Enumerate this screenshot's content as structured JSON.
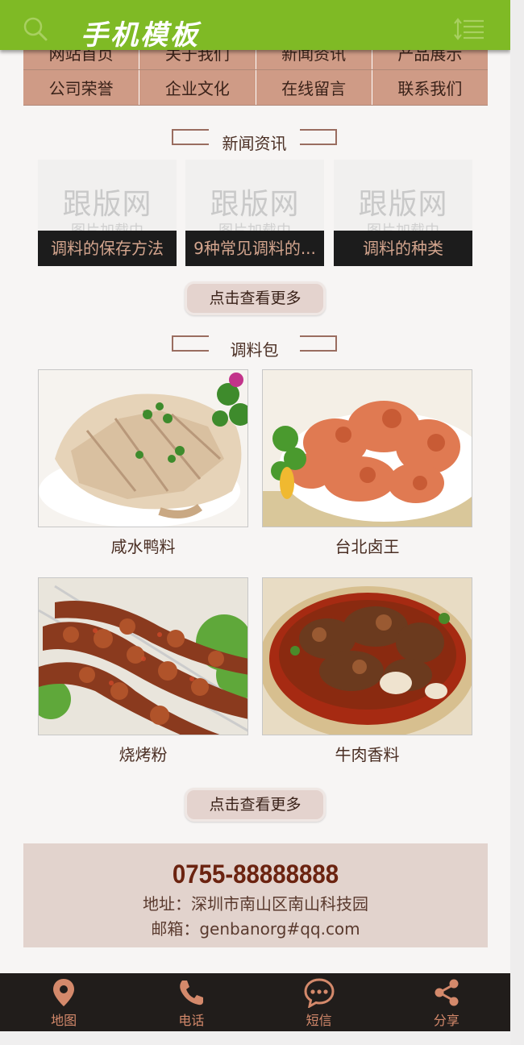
{
  "header": {
    "title": "手机模板",
    "search_icon": "search-icon",
    "menu_icon": "menu-list-icon",
    "bg_color": "#7fba25"
  },
  "nav": {
    "row1": [
      "网站首页",
      "关于我们",
      "新闻资讯",
      "产品展示"
    ],
    "row2": [
      "公司荣誉",
      "企业文化",
      "在线留言",
      "联系我们"
    ]
  },
  "news": {
    "section_title": "新闻资讯",
    "placeholder_big": "跟版网",
    "placeholder_small": "图片加载中",
    "items": [
      {
        "title": "调料的保存方法"
      },
      {
        "title": "9种常见调料的..."
      },
      {
        "title": "调料的种类"
      }
    ],
    "more_label": "点击查看更多"
  },
  "products": {
    "section_title": "调料包",
    "items": [
      {
        "name": "咸水鸭料"
      },
      {
        "name": "台北卤王"
      },
      {
        "name": "烧烤粉"
      },
      {
        "name": "牛肉香料"
      }
    ],
    "more_label": "点击查看更多"
  },
  "contact": {
    "phone": "0755-88888888",
    "address": "地址：深圳市南山区南山科技园",
    "email": "邮箱：genbanorg#qq.com"
  },
  "bottom_bar": {
    "tabs": [
      {
        "label": "地图",
        "icon": "map-pin-icon"
      },
      {
        "label": "电话",
        "icon": "phone-icon"
      },
      {
        "label": "短信",
        "icon": "message-icon"
      },
      {
        "label": "分享",
        "icon": "share-icon"
      }
    ],
    "accent": "#d4896b"
  }
}
